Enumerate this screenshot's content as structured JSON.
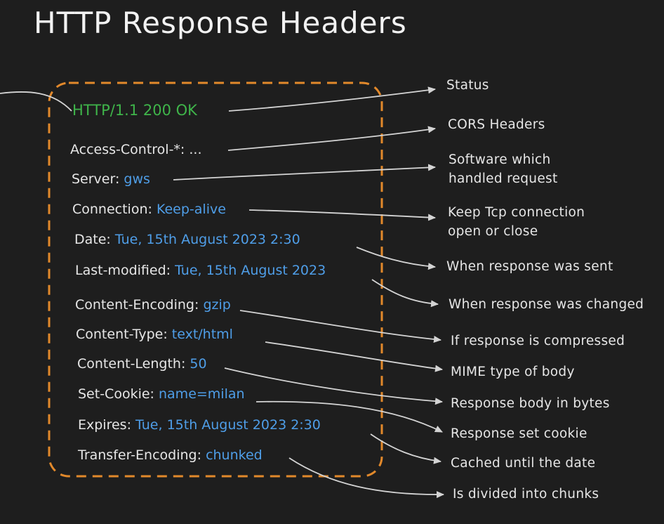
{
  "title": "HTTP Response Headers",
  "colors": {
    "background": "#1e1e1e",
    "box_border": "#e2892b",
    "status_text": "#3fb54a",
    "value_text": "#4f9ee8",
    "plain_text": "#e6e6e6"
  },
  "status_line": "HTTP/1.1 200 OK",
  "headers": [
    {
      "name": "Access-Control-*:",
      "value": "..."
    },
    {
      "name": "Server:",
      "value": "gws"
    },
    {
      "name": "Connection:",
      "value": "Keep-alive"
    },
    {
      "name": "Date:",
      "value": "Tue, 15th August 2023 2:30"
    },
    {
      "name": "Last-modified:",
      "value": "Tue, 15th August 2023"
    },
    {
      "name": "Content-Encoding:",
      "value": "gzip"
    },
    {
      "name": "Content-Type:",
      "value": "text/html"
    },
    {
      "name": "Content-Length:",
      "value": "50"
    },
    {
      "name": "Set-Cookie:",
      "value": "name=milan"
    },
    {
      "name": "Expires:",
      "value": "Tue, 15th August 2023 2:30"
    },
    {
      "name": "Transfer-Encoding:",
      "value": "chunked"
    }
  ],
  "descriptions": [
    "Status",
    "CORS Headers",
    "Software which\nhandled request",
    "Keep Tcp connection\nopen or close",
    "When response was sent",
    "When response was changed",
    "If response is compressed",
    "MIME type of body",
    "Response body in bytes",
    "Response set cookie",
    "Cached until the date",
    "Is divided into chunks"
  ]
}
